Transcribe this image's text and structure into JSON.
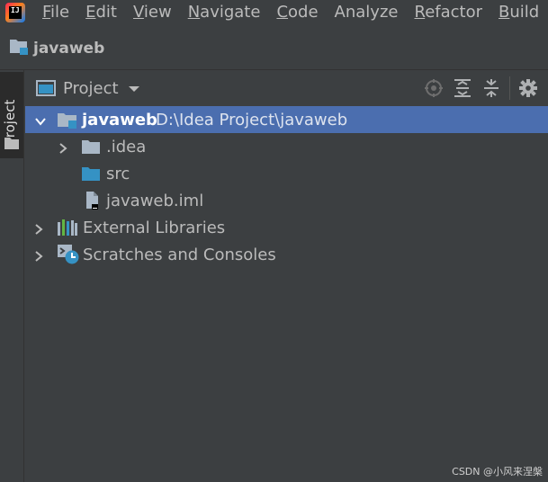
{
  "app": {
    "logo_text": "IJ"
  },
  "menu": {
    "items": [
      {
        "mnemonic": "F",
        "rest": "ile"
      },
      {
        "mnemonic": "E",
        "rest": "dit"
      },
      {
        "mnemonic": "V",
        "rest": "iew"
      },
      {
        "mnemonic": "N",
        "rest": "avigate"
      },
      {
        "mnemonic": "C",
        "rest": "ode"
      },
      {
        "mnemonic": "",
        "rest": "Analyze"
      },
      {
        "mnemonic": "R",
        "rest": "efactor"
      },
      {
        "mnemonic": "B",
        "rest": "uild"
      }
    ]
  },
  "navbar": {
    "project_name": "javaweb"
  },
  "sidebar": {
    "tab_label": "Project"
  },
  "panel": {
    "title": "Project"
  },
  "tree": {
    "root": {
      "label": "javaweb",
      "path": "D:\\Idea Project\\javaweb"
    },
    "idea": {
      "label": ".idea"
    },
    "src": {
      "label": "src"
    },
    "iml": {
      "label": "javaweb.iml"
    },
    "libs": {
      "label": "External Libraries"
    },
    "scratches": {
      "label": "Scratches and Consoles"
    }
  },
  "colors": {
    "background": "#3c3f41",
    "selection": "#4b6eaf",
    "folder_blue": "#3592c4",
    "folder_gray": "#a9b7c6"
  },
  "watermark": "CSDN @小风来涅槃"
}
